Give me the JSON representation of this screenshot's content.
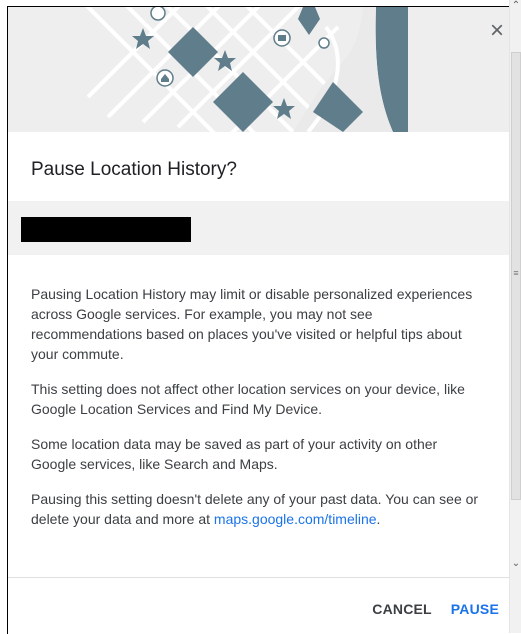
{
  "dialog": {
    "title": "Pause Location History?",
    "close_label": "×",
    "paragraphs": {
      "p1": "Pausing Location History may limit or disable personalized experiences across Google services. For example, you may not see recommendations based on places you've visited or helpful tips about your commute.",
      "p2": "This setting does not affect other location services on your device, like Google Location Services and Find My Device.",
      "p3": "Some location data may be saved as part of your activity on other Google services, like Search and Maps.",
      "p4_text": "Pausing this setting doesn't delete any of your past data. You can see or delete your data and more at ",
      "p4_link": "maps.google.com/timeline",
      "p4_end": "."
    },
    "buttons": {
      "cancel": "CANCEL",
      "pause": "PAUSE"
    }
  },
  "scrollbar": {
    "up_arrow": "⌃",
    "down_arrow": "⌄",
    "grip": "≡"
  },
  "colors": {
    "accent": "#1a73e8",
    "map_shape": "#5f7d8a",
    "hero_bg": "#eeeeee",
    "account_band": "#f1f1f1"
  }
}
